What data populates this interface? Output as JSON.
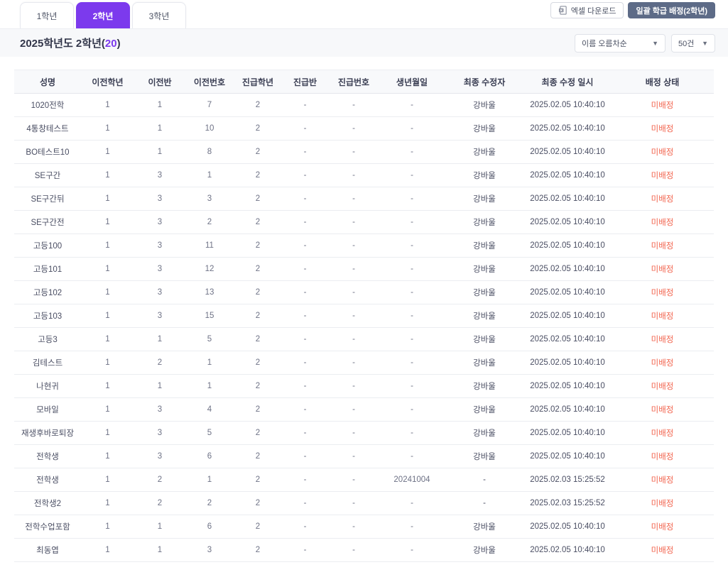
{
  "tabs": [
    {
      "label": "1학년",
      "active": false
    },
    {
      "label": "2학년",
      "active": true
    },
    {
      "label": "3학년",
      "active": false
    }
  ],
  "toolbar": {
    "excel_label": "엑셀 다운로드",
    "batch_label": "일괄 학급 배정(2학년)"
  },
  "header": {
    "title_prefix": "2025학년도 2학년",
    "paren_open": "(",
    "count": "20",
    "paren_close": ")"
  },
  "controls": {
    "sort_value": "이름 오름차순",
    "page_size_value": "50건",
    "chevron": "▼"
  },
  "colors": {
    "accent_purple": "#7c3aed",
    "batch_button": "#5d6b87",
    "status_unassigned": "#f2654f"
  },
  "table": {
    "columns": [
      "성명",
      "이전학년",
      "이전반",
      "이전번호",
      "진급학년",
      "진급반",
      "진급번호",
      "생년월일",
      "최종 수정자",
      "최종 수정 일시",
      "배정 상태"
    ],
    "rows": [
      [
        "1020전학",
        "1",
        "1",
        "7",
        "2",
        "-",
        "-",
        "-",
        "강바울",
        "2025.02.05 10:40:10",
        "미배정"
      ],
      [
        "4통창테스트",
        "1",
        "1",
        "10",
        "2",
        "-",
        "-",
        "-",
        "강바울",
        "2025.02.05 10:40:10",
        "미배정"
      ],
      [
        "BO테스트10",
        "1",
        "1",
        "8",
        "2",
        "-",
        "-",
        "-",
        "강바울",
        "2025.02.05 10:40:10",
        "미배정"
      ],
      [
        "SE구간",
        "1",
        "3",
        "1",
        "2",
        "-",
        "-",
        "-",
        "강바울",
        "2025.02.05 10:40:10",
        "미배정"
      ],
      [
        "SE구간뒤",
        "1",
        "3",
        "3",
        "2",
        "-",
        "-",
        "-",
        "강바울",
        "2025.02.05 10:40:10",
        "미배정"
      ],
      [
        "SE구간전",
        "1",
        "3",
        "2",
        "2",
        "-",
        "-",
        "-",
        "강바울",
        "2025.02.05 10:40:10",
        "미배정"
      ],
      [
        "고등100",
        "1",
        "3",
        "11",
        "2",
        "-",
        "-",
        "-",
        "강바울",
        "2025.02.05 10:40:10",
        "미배정"
      ],
      [
        "고등101",
        "1",
        "3",
        "12",
        "2",
        "-",
        "-",
        "-",
        "강바울",
        "2025.02.05 10:40:10",
        "미배정"
      ],
      [
        "고등102",
        "1",
        "3",
        "13",
        "2",
        "-",
        "-",
        "-",
        "강바울",
        "2025.02.05 10:40:10",
        "미배정"
      ],
      [
        "고등103",
        "1",
        "3",
        "15",
        "2",
        "-",
        "-",
        "-",
        "강바울",
        "2025.02.05 10:40:10",
        "미배정"
      ],
      [
        "고등3",
        "1",
        "1",
        "5",
        "2",
        "-",
        "-",
        "-",
        "강바울",
        "2025.02.05 10:40:10",
        "미배정"
      ],
      [
        "김테스트",
        "1",
        "2",
        "1",
        "2",
        "-",
        "-",
        "-",
        "강바울",
        "2025.02.05 10:40:10",
        "미배정"
      ],
      [
        "나현귀",
        "1",
        "1",
        "1",
        "2",
        "-",
        "-",
        "-",
        "강바울",
        "2025.02.05 10:40:10",
        "미배정"
      ],
      [
        "모바일",
        "1",
        "3",
        "4",
        "2",
        "-",
        "-",
        "-",
        "강바울",
        "2025.02.05 10:40:10",
        "미배정"
      ],
      [
        "재생후바로퇴장",
        "1",
        "3",
        "5",
        "2",
        "-",
        "-",
        "-",
        "강바울",
        "2025.02.05 10:40:10",
        "미배정"
      ],
      [
        "전학생",
        "1",
        "3",
        "6",
        "2",
        "-",
        "-",
        "-",
        "강바울",
        "2025.02.05 10:40:10",
        "미배정"
      ],
      [
        "전학생",
        "1",
        "2",
        "1",
        "2",
        "-",
        "-",
        "20241004",
        "-",
        "2025.02.03 15:25:52",
        "미배정"
      ],
      [
        "전학생2",
        "1",
        "2",
        "2",
        "2",
        "-",
        "-",
        "-",
        "-",
        "2025.02.03 15:25:52",
        "미배정"
      ],
      [
        "전학수업포함",
        "1",
        "1",
        "6",
        "2",
        "-",
        "-",
        "-",
        "강바울",
        "2025.02.05 10:40:10",
        "미배정"
      ],
      [
        "최동엽",
        "1",
        "1",
        "3",
        "2",
        "-",
        "-",
        "-",
        "강바울",
        "2025.02.05 10:40:10",
        "미배정"
      ]
    ]
  }
}
